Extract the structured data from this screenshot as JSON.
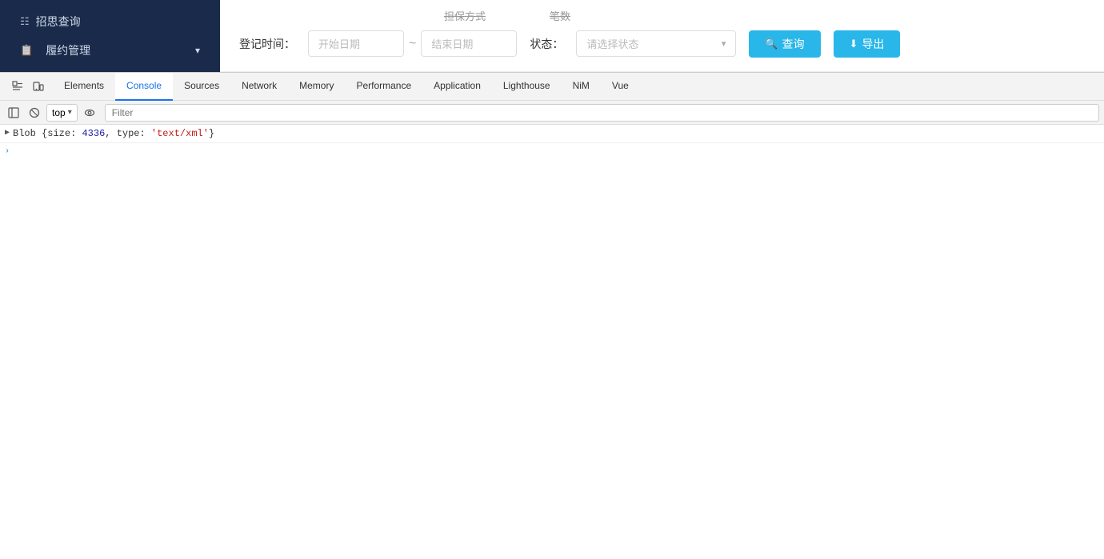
{
  "sidebar": {
    "item1_icon": "☰",
    "item1_label": "招思查询",
    "item2_icon": "📋",
    "item2_label": "履约管理",
    "item2_arrow": "▾"
  },
  "topbar": {
    "label_time": "登记时间：",
    "placeholder_start": "开始日期",
    "separator": "~",
    "placeholder_end": "结束日期",
    "label_status": "状态：",
    "placeholder_status": "请选择状态",
    "btn_query": "查询",
    "btn_export": "导出",
    "strikethrough1": "担保方式",
    "strikethrough2": "笔数"
  },
  "devtools": {
    "tabs": [
      {
        "id": "elements",
        "label": "Elements"
      },
      {
        "id": "console",
        "label": "Console"
      },
      {
        "id": "sources",
        "label": "Sources"
      },
      {
        "id": "network",
        "label": "Network"
      },
      {
        "id": "memory",
        "label": "Memory"
      },
      {
        "id": "performance",
        "label": "Performance"
      },
      {
        "id": "application",
        "label": "Application"
      },
      {
        "id": "lighthouse",
        "label": "Lighthouse"
      },
      {
        "id": "nim",
        "label": "NiM"
      },
      {
        "id": "vue",
        "label": "Vue"
      }
    ],
    "toolbar": {
      "context": "top",
      "filter_placeholder": "Filter"
    },
    "console_output": {
      "blob_prefix": "▶ Blob {size: ",
      "blob_size": "4336",
      "blob_type_key": ", type: ",
      "blob_type_val": "'text/xml'",
      "blob_suffix": "}"
    }
  }
}
